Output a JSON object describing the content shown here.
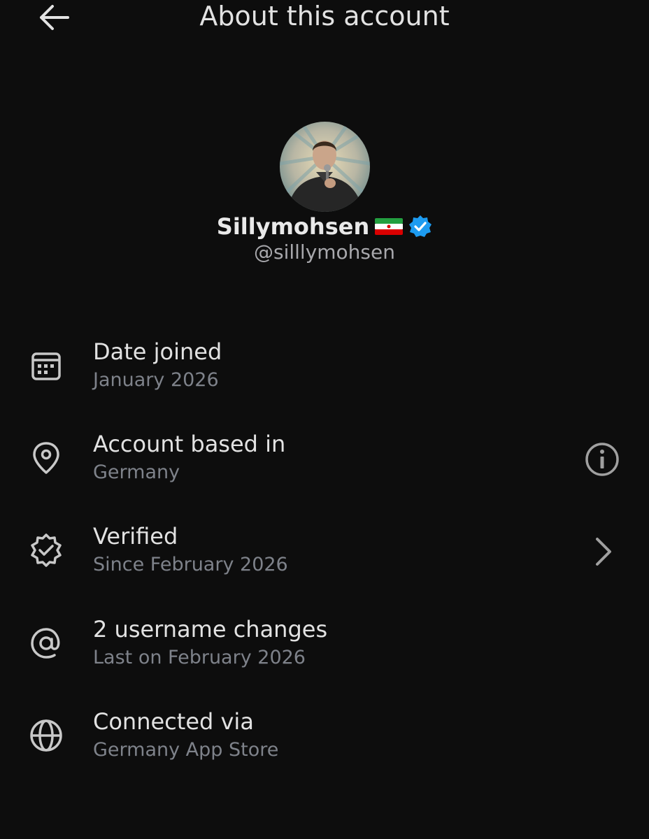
{
  "header": {
    "title": "About this account",
    "back_icon": "arrow-left-icon"
  },
  "profile": {
    "name": "Sillymohsen",
    "flag_icon": "iran-flag-emoji",
    "verified_icon": "verified-badge-icon",
    "handle": "@silllymohsen"
  },
  "rows": [
    {
      "icon": "calendar-icon",
      "label": "Date joined",
      "value": "January 2026"
    },
    {
      "icon": "location-pin-icon",
      "label": "Account based in",
      "value": "Germany",
      "trailing_icon": "info-icon"
    },
    {
      "icon": "verified-outline-icon",
      "label": "Verified",
      "value": "Since February 2026",
      "trailing_icon": "chevron-right-icon"
    },
    {
      "icon": "at-sign-icon",
      "label": "2 username changes",
      "value": "Last on February 2026"
    },
    {
      "icon": "globe-icon",
      "label": "Connected via",
      "value": "Germany App Store"
    }
  ],
  "colors": {
    "background": "#0d0d0d",
    "primary_text": "#e2e2e2",
    "secondary_text": "#7e828a",
    "verified_blue": "#1d9bf0"
  }
}
